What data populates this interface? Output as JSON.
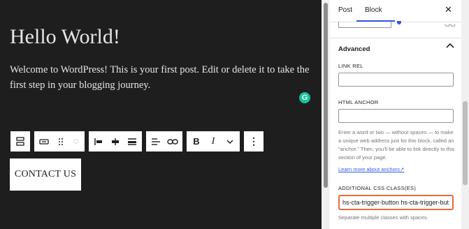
{
  "canvas": {
    "title": "Hello World!",
    "body": "Welcome to WordPress! This is your first post. Edit or delete it to take the first step in your blogging journey.",
    "grammarly_icon": "G",
    "button_text": "CONTACT US"
  },
  "toolbar": {
    "items": [
      "block-type-icon",
      "button-icon",
      "drag-handle-icon",
      "move-up-down-icons",
      "justify-left-icon",
      "justify-center-icon",
      "justify-space-between-icon",
      "align-icon",
      "link-icon",
      "bold-icon",
      "italic-icon",
      "chevron-down-icon",
      "more-options-icon"
    ],
    "bold": "B",
    "italic": "I",
    "more": "⋮"
  },
  "sidebar": {
    "tab_post": "Post",
    "tab_block": "Block",
    "close": "✕",
    "advanced_title": "Advanced",
    "link_rel_label": "LINK REL",
    "link_rel_value": "",
    "html_anchor_label": "HTML ANCHOR",
    "html_anchor_value": "",
    "anchor_help": "Enter a word or two — without spaces — to make a unique web address just for this block, called an \"anchor.\" Then, you'll be able to link directly to this section of your page.",
    "learn_more": "Learn more about anchors",
    "css_label": "ADDITIONAL CSS CLASS(ES)",
    "css_value": "hs-cta-trigger-button hs-cta-trigger-but",
    "css_help": "Separate multiple classes with spaces."
  },
  "colors": {
    "accent": "#3858e9",
    "highlight": "#e8693c",
    "canvas_bg": "#1e1e1e"
  }
}
